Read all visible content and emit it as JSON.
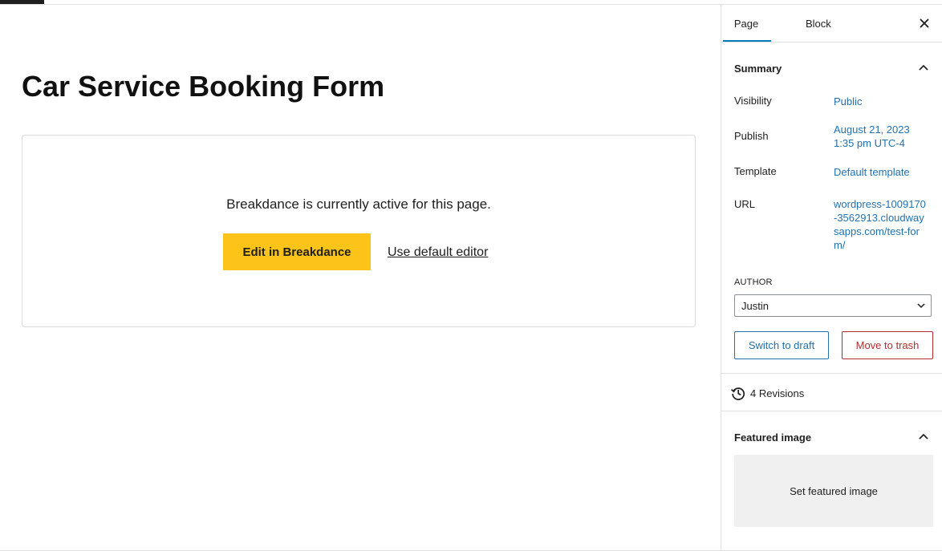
{
  "editor": {
    "title": "Car Service Booking Form",
    "breakdance": {
      "message": "Breakdance is currently active for this page.",
      "edit_label": "Edit in Breakdance",
      "default_label": "Use default editor",
      "accent_color": "#fcc419"
    }
  },
  "sidebar": {
    "tabs": [
      {
        "label": "Page",
        "active": true
      },
      {
        "label": "Block",
        "active": false
      }
    ],
    "summary": {
      "title": "Summary",
      "rows": [
        {
          "label": "Visibility",
          "value": "Public"
        },
        {
          "label": "Publish",
          "value_line1": "August 21, 2023",
          "value_line2": "1:35 pm UTC-4"
        },
        {
          "label": "Template",
          "value": "Default template"
        },
        {
          "label": "URL",
          "value": "wordpress-1009170-3562913.cloudwaysapps.com/test-form/"
        }
      ],
      "author_label": "AUTHOR",
      "author_value": "Justin",
      "switch_draft_label": "Switch to draft",
      "move_trash_label": "Move to trash"
    },
    "revisions": {
      "label": "4 Revisions",
      "icon": "history-icon"
    },
    "featured_image": {
      "title": "Featured image",
      "set_label": "Set featured image"
    }
  },
  "colors": {
    "link": "#2271b1",
    "danger": "#b32d2e",
    "tab_active": "#007cba"
  }
}
